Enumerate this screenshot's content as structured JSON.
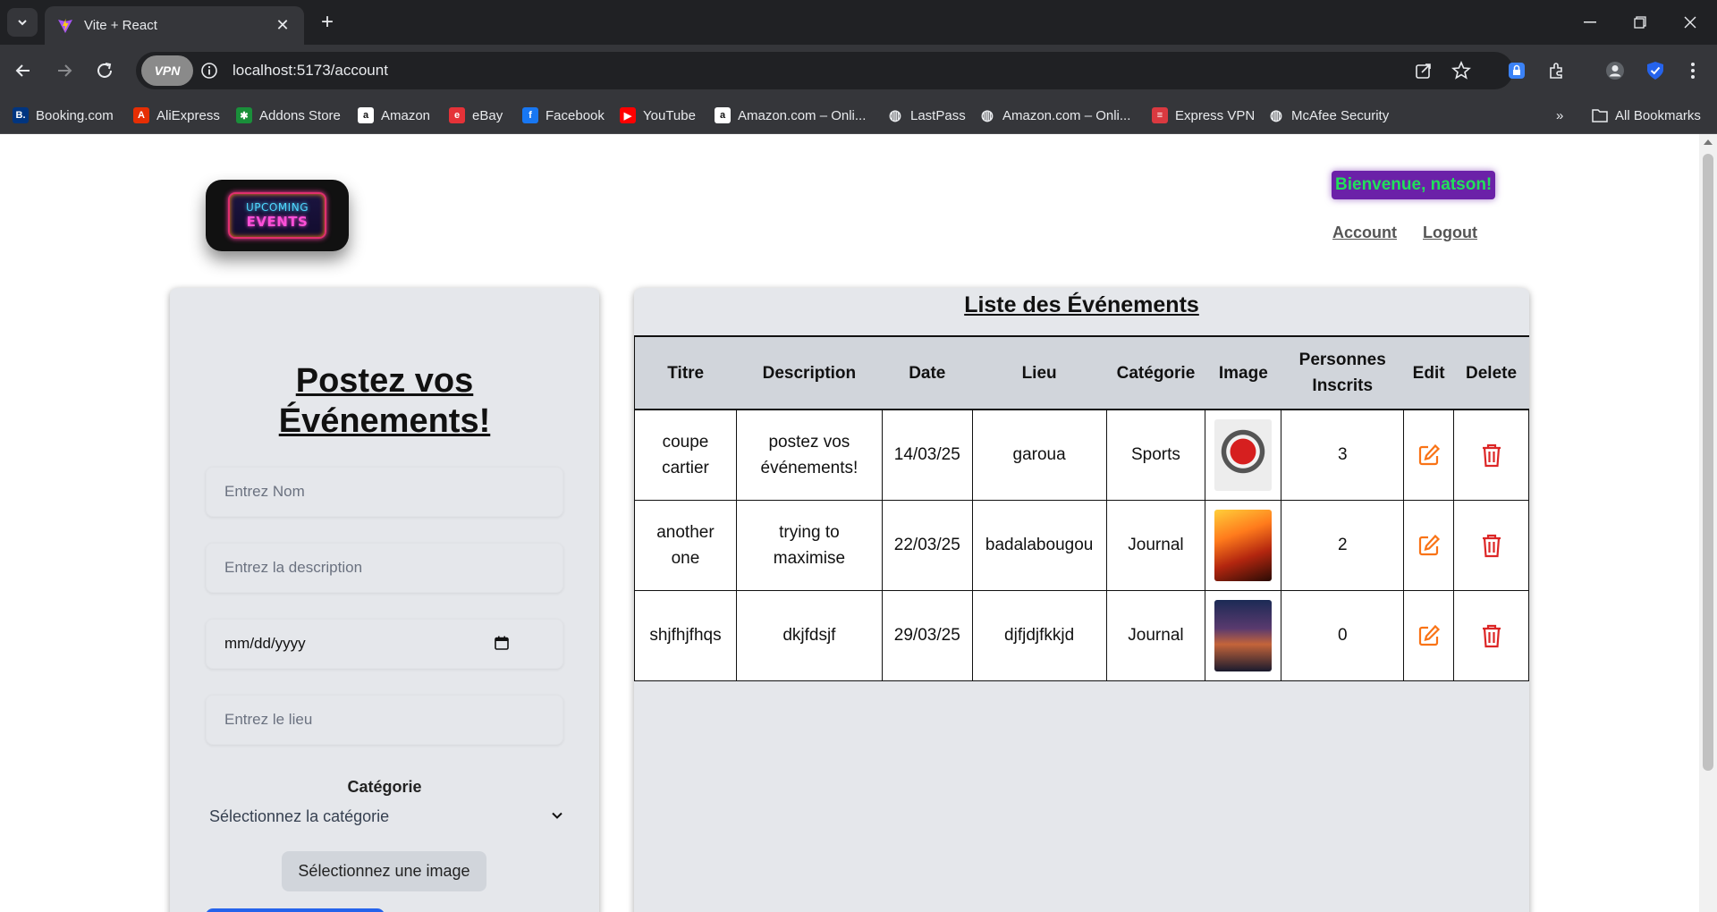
{
  "browser": {
    "tab_title": "Vite + React",
    "url_host": "localhost",
    "url_path": ":5173/account",
    "vpn_label": "VPN",
    "bookmarks": [
      {
        "label": "Booking.com",
        "icon": "booking-icon",
        "color": "#003580",
        "glyph": "B."
      },
      {
        "label": "AliExpress",
        "icon": "aliexpress-icon",
        "color": "#e62e04",
        "glyph": "A"
      },
      {
        "label": "Addons Store",
        "icon": "addons-store-icon",
        "color": "#1a8f3a",
        "glyph": "✱"
      },
      {
        "label": "Amazon",
        "icon": "amazon-icon",
        "color": "#ffffff",
        "glyph": "a"
      },
      {
        "label": "eBay",
        "icon": "ebay-icon",
        "color": "#e53238",
        "glyph": "e"
      },
      {
        "label": "Facebook",
        "icon": "facebook-icon",
        "color": "#1877f2",
        "glyph": "f"
      },
      {
        "label": "YouTube",
        "icon": "youtube-icon",
        "color": "#ff0000",
        "glyph": "▶"
      },
      {
        "label": "Amazon.com – Onli...",
        "icon": "amazon-icon",
        "color": "#ffffff",
        "glyph": "a"
      },
      {
        "label": "LastPass",
        "icon": "globe-icon",
        "color": "#5f6368",
        "glyph": "◍"
      },
      {
        "label": "Amazon.com – Onli...",
        "icon": "globe-icon",
        "color": "#5f6368",
        "glyph": "◍"
      },
      {
        "label": "Express VPN",
        "icon": "expressvpn-icon",
        "color": "#da3940",
        "glyph": "≡"
      },
      {
        "label": "McAfee Security",
        "icon": "globe-icon",
        "color": "#5f6368",
        "glyph": "◍"
      }
    ],
    "all_bookmarks": "All Bookmarks"
  },
  "header": {
    "logo_line1": "UPCOMING",
    "logo_line2": "EVENTS",
    "welcome": "Bienvenue, natson!",
    "account_link": "Account",
    "logout_link": "Logout"
  },
  "form": {
    "title_line1": "Postez vos",
    "title_line2": "Événements!",
    "name_placeholder": "Entrez Nom",
    "description_placeholder": "Entrez la description",
    "date_value": "mm/dd/yyyy",
    "location_placeholder": "Entrez le lieu",
    "category_label": "Catégorie",
    "category_selected": "Sélectionnez la catégorie",
    "image_button": "Sélectionnez une image"
  },
  "events": {
    "title": "Liste des Événements",
    "columns": [
      "Titre",
      "Description",
      "Date",
      "Lieu",
      "Catégorie",
      "Image",
      "Personnes Inscrits",
      "Edit",
      "Delete"
    ],
    "rows": [
      {
        "title": "coupe cartier",
        "description": "postez vos événements!",
        "date": "14/03/25",
        "location": "garoua",
        "category": "Sports",
        "registered": "3"
      },
      {
        "title": "another one",
        "description": "trying to maximise",
        "date": "22/03/25",
        "location": "badalabougou",
        "category": "Journal",
        "registered": "2"
      },
      {
        "title": "shjfhjfhqs",
        "description": "dkjfdsjf",
        "date": "29/03/25",
        "location": "djfjdjfkkjd",
        "category": "Journal",
        "registered": "0"
      }
    ]
  },
  "colors": {
    "welcome_bg": "#6b21a8",
    "welcome_text": "#22e05a",
    "edit_icon": "#f97316",
    "delete_icon": "#dc2626",
    "submit_button": "#2563eb"
  }
}
